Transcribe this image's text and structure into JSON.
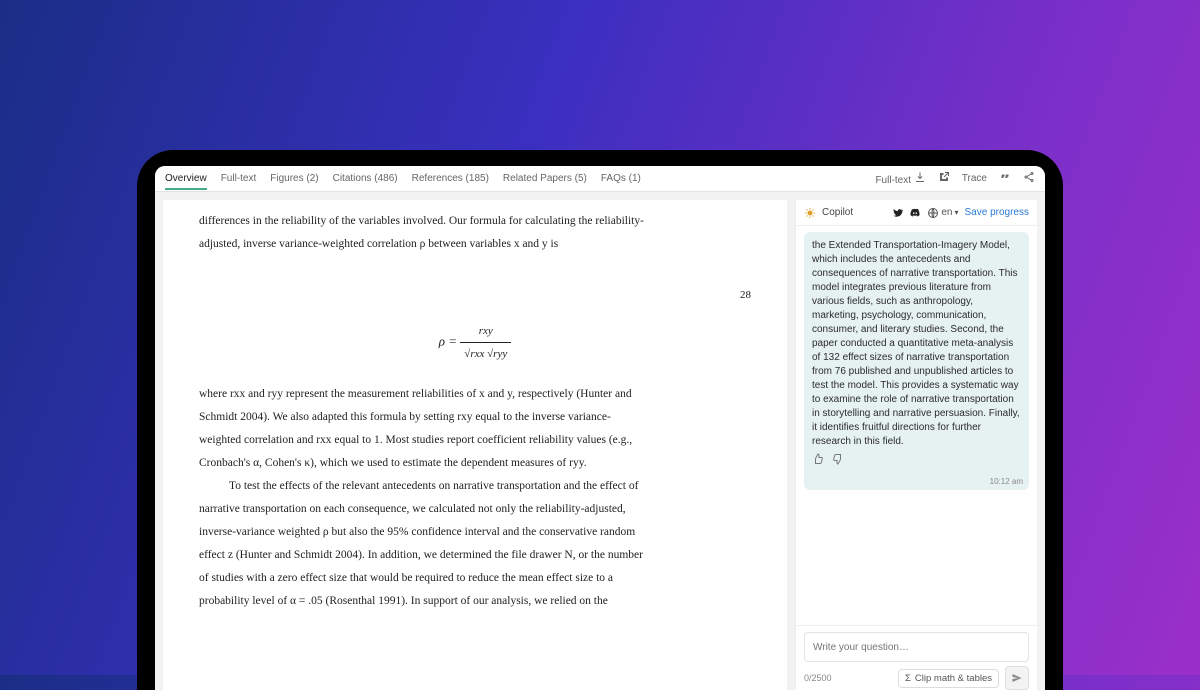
{
  "tabs": {
    "overview": "Overview",
    "fulltext": "Full-text",
    "figures": "Figures (2)",
    "citations": "Citations (486)",
    "references": "References (185)",
    "related": "Related Papers (5)",
    "faqs": "FAQs (1)"
  },
  "actions": {
    "fulltext_dl": "Full-text",
    "trace": "Trace"
  },
  "paper": {
    "p1": "differences in the reliability of the variables involved. Our formula for calculating the reliability-",
    "p2": "adjusted, inverse variance-weighted correlation ρ between variables x and y is",
    "pagenum": "28",
    "formula_lhs": "ρ =",
    "formula_num": "rxy",
    "formula_den": "√rxx √ryy",
    "p3": "where rxx and ryy represent the measurement reliabilities of x and y, respectively (Hunter and",
    "p4": "Schmidt 2004). We also adapted this formula by setting rxy equal to the inverse variance-",
    "p5": "weighted correlation and rxx equal to 1. Most studies report coefficient reliability values (e.g.,",
    "p6": "Cronbach's α, Cohen's κ), which we used to estimate the dependent measures of ryy.",
    "p7": "To test the effects of the relevant antecedents on narrative transportation and the effect of",
    "p8": "narrative transportation on each consequence, we calculated not only the reliability-adjusted,",
    "p9": "inverse-variance weighted ρ but also the 95% confidence interval and the conservative random",
    "p10": "effect z (Hunter and Schmidt 2004). In addition, we determined the file drawer N, or the number",
    "p11": "of studies with a zero effect size that would be required to reduce the mean effect size to a",
    "p12": "probability level of α = .05 (Rosenthal 1991). In support of our analysis, we relied on the"
  },
  "copilot": {
    "brand": "Copilot",
    "lang": "en",
    "save": "Save progress",
    "message": "the Extended Transportation-Imagery Model, which includes the antecedents and consequences of narrative transportation. This model integrates previous literature from various fields, such as anthropology, marketing, psychology, communication, consumer, and literary studies. Second, the paper conducted a quantitative meta-analysis of 132 effect sizes of narrative transportation from 76 published and unpublished articles to test the model. This provides a systematic way to examine the role of narrative transportation in storytelling and narrative persuasion. Finally, it identifies fruitful directions for further research in this field.",
    "timestamp": "10:12 am",
    "placeholder": "Write your question…",
    "counter": "0/2500",
    "clip": "Clip math & tables"
  }
}
